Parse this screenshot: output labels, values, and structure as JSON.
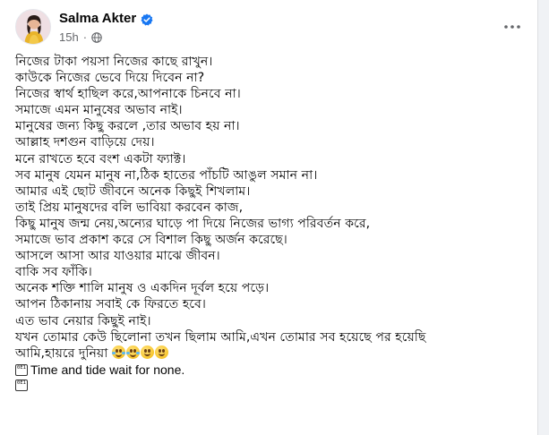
{
  "post": {
    "author": "Salma Akter",
    "timestamp": "15h",
    "separator": "·",
    "audience_icon": "globe-icon",
    "verified_icon": "verified-badge-icon",
    "more_icon": "more-options-icon",
    "accent": "#1877f2",
    "lines": [
      "নিজের টাকা পয়সা নিজের কাছে রাখুন।",
      "কাউকে নিজের ভেবে দিয়ে দিবেন না?",
      "নিজের স্বার্থ হাছিল করে,আপনাকে চিনবে না।",
      "সমাজে এমন মানুষের অভাব নাই।",
      "মানুষের জন্য কিছু করলে ,তার অভাব হয় না।",
      "আল্লাহ দশগুন বাড়িয়ে দেয়।",
      "মনে রাখতে হবে বংশ একটা ফ্যাক্ট।",
      "সব মানুষ যেমন মানুষ না,ঠিক হাতের পাঁচটি আঙুল সমান না।",
      "আমার এই ছোট জীবনে অনেক কিছুই শিখলাম।",
      "তাই প্রিয় মানুষদের বলি ভাবিয়া করবেন কাজ,",
      "কিছু মানুষ জন্ম নেয়,অন্যের ঘাড়ে পা দিয়ে নিজের ভাগ্য পরিবর্তন করে,",
      "সমাজে ভাব প্রকাশ করে সে বিশাল কিছু অর্জন করেছে।",
      "আসলে আসা আর যাওয়ার মাঝে জীবন।",
      "বাকি সব ফাঁকি।",
      "অনেক শক্তি শালি মানুষ ও একদিন দূর্বল হয়ে পড়ে।",
      "আপন ঠিকানায় সবাই কে ফিরতে হবে।",
      "এত ভাব নেয়ার কিছুই নাই।",
      "যখন তোমার কেউ ছিলোনা তখন ছিলাম আমি,এখন তোমার সব হয়েছে পর হয়েছি",
      "আমি,হায়রে দুনিয়া"
    ],
    "emojis": [
      "tears-of-joy-emoji",
      "tears-of-joy-emoji",
      "smiling-face-emoji",
      "smiling-face-emoji"
    ],
    "tag_glyph": "0E1",
    "english_line": "Time and tide wait for none."
  }
}
